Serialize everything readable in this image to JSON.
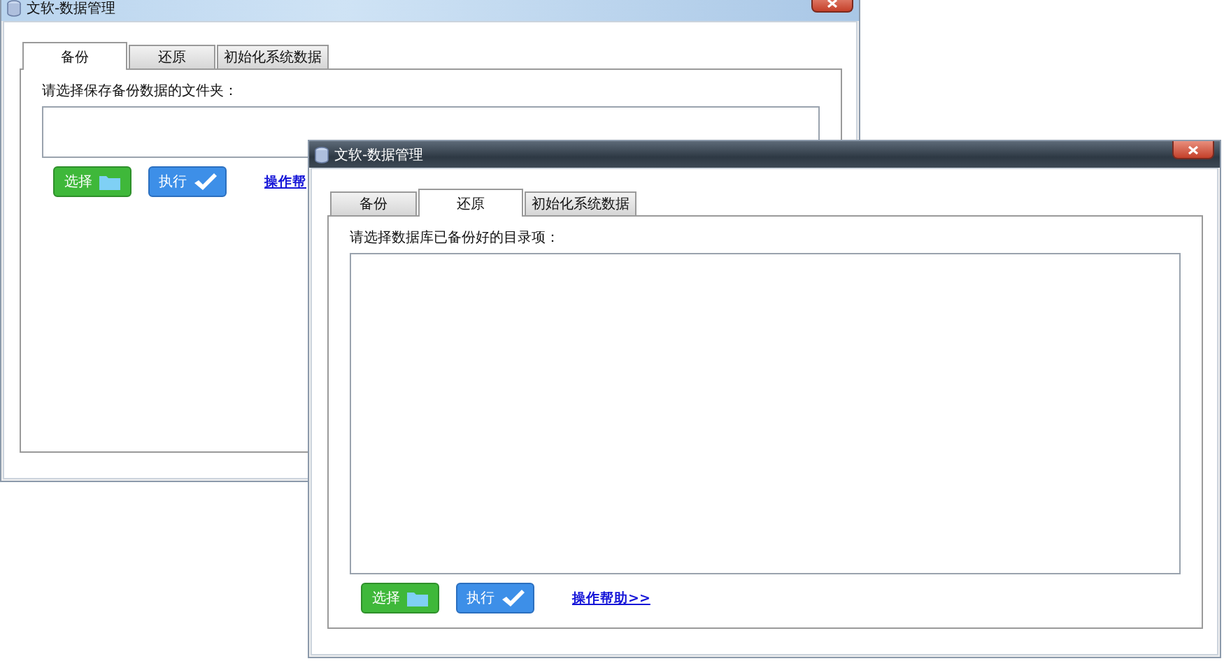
{
  "windows": [
    {
      "title": "文软-数据管理",
      "active": false,
      "tabs": [
        {
          "label": "备份",
          "selected": true
        },
        {
          "label": "还原",
          "selected": false
        },
        {
          "label": "初始化系统数据",
          "selected": false
        }
      ],
      "prompt": "请选择保存备份数据的文件夹：",
      "field": {
        "kind": "input"
      },
      "buttons": [
        {
          "label": "选择",
          "kind": "choose"
        },
        {
          "label": "执行",
          "kind": "run"
        }
      ],
      "help_link": "操作帮"
    },
    {
      "title": "文软-数据管理",
      "active": true,
      "tabs": [
        {
          "label": "备份",
          "selected": false
        },
        {
          "label": "还原",
          "selected": true
        },
        {
          "label": "初始化系统数据",
          "selected": false
        }
      ],
      "prompt": "请选择数据库已备份好的目录项：",
      "field": {
        "kind": "list"
      },
      "buttons": [
        {
          "label": "选择",
          "kind": "choose"
        },
        {
          "label": "执行",
          "kind": "run"
        }
      ],
      "help_link": "操作帮助>>"
    }
  ]
}
